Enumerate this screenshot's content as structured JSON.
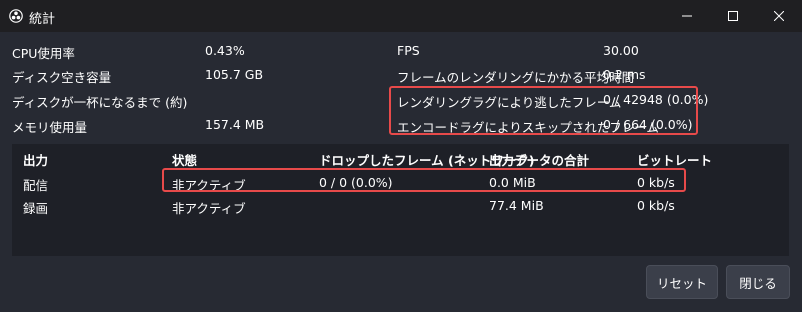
{
  "window": {
    "title": "統計"
  },
  "stats_left": [
    {
      "label": "CPU使用率",
      "value": "0.43%"
    },
    {
      "label": "ディスク空き容量",
      "value": "105.7 GB"
    },
    {
      "label": "ディスクが一杯になるまで (約)",
      "value": ""
    },
    {
      "label": "メモリ使用量",
      "value": "157.4 MB"
    }
  ],
  "stats_right": [
    {
      "label": "FPS",
      "value": "30.00"
    },
    {
      "label": "フレームのレンダリングにかかる平均時間",
      "value": "0.2 ms"
    },
    {
      "label": "レンダリングラグにより逃したフレーム",
      "value": "0 / 42948 (0.0%)"
    },
    {
      "label": "エンコードラグによりスキップされたフレーム",
      "value": "0 / 664 (0.0%)"
    }
  ],
  "output_table": {
    "headers": [
      "出力",
      "状態",
      "ドロップしたフレーム (ネットワーク)",
      "出力データの合計",
      "ビットレート"
    ],
    "rows": [
      [
        "配信",
        "非アクティブ",
        "0 / 0 (0.0%)",
        "0.0 MiB",
        "0 kb/s"
      ],
      [
        "録画",
        "非アクティブ",
        "",
        "77.4 MiB",
        "0 kb/s"
      ]
    ]
  },
  "buttons": {
    "reset": "リセット",
    "close": "閉じる"
  },
  "colors": {
    "background": "#272a33",
    "panel": "#1e2027",
    "titlebar": "#1f1f22",
    "highlight": "#e74a4a",
    "button": "#3b3f4a"
  }
}
